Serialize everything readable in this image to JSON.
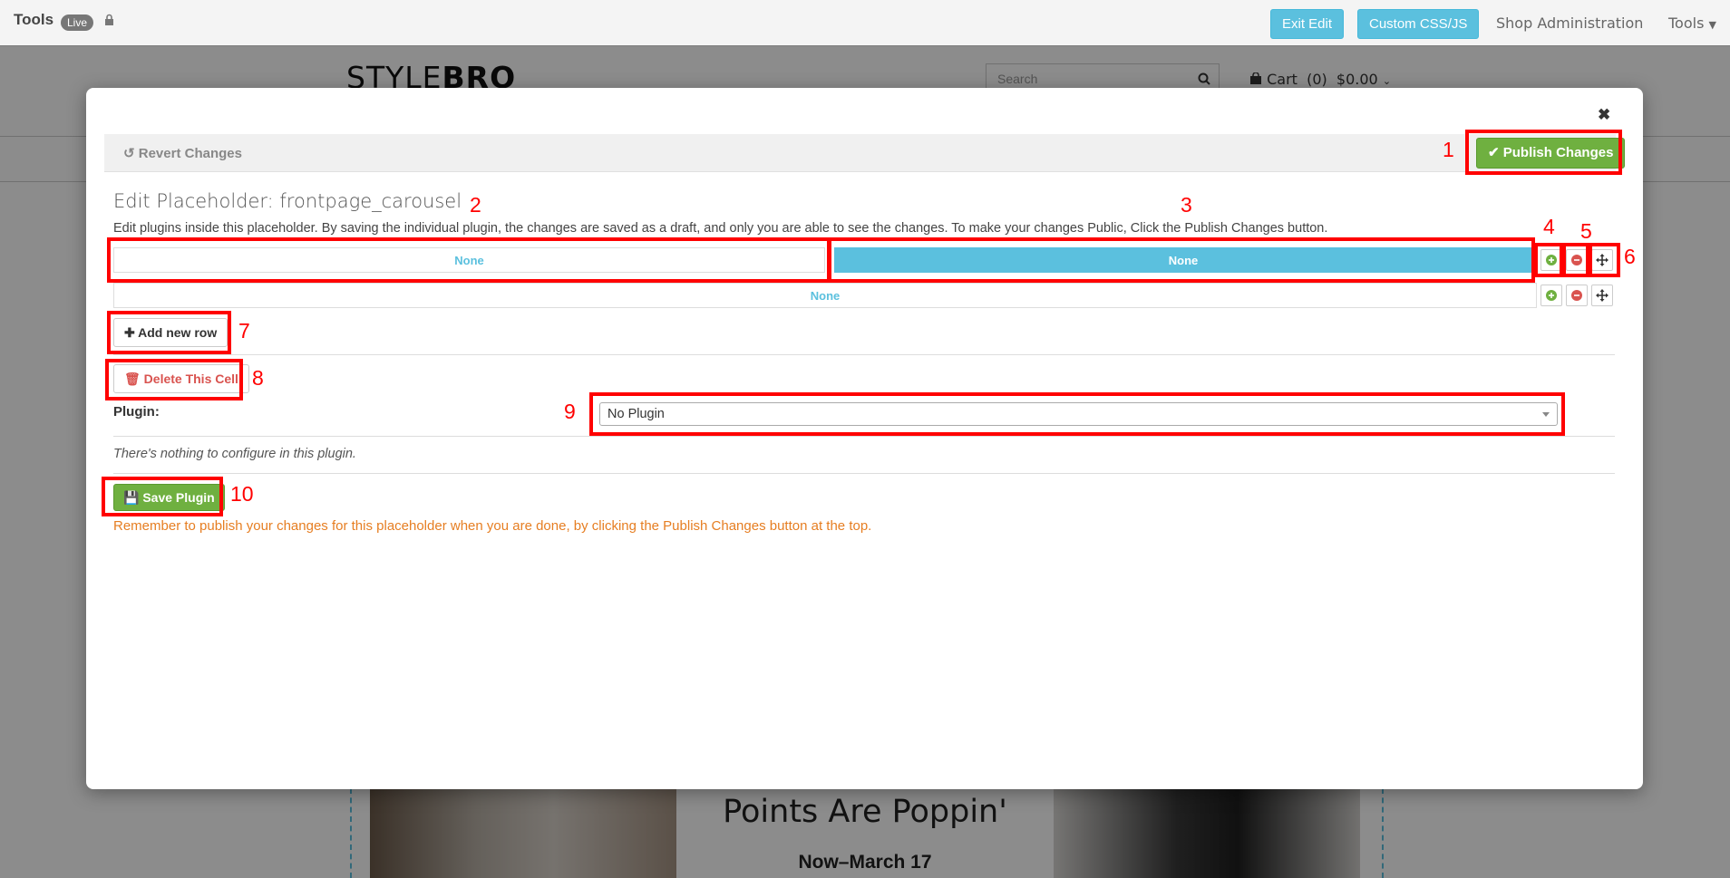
{
  "adminbar": {
    "title": "Tools",
    "live_badge": "Live",
    "exit_edit": "Exit Edit",
    "custom_css_js": "Custom CSS/JS",
    "shop_admin": "Shop Administration",
    "tools_menu": "Tools"
  },
  "site": {
    "logo_light": "STYLE",
    "logo_bold": "BRO",
    "search_placeholder": "Search",
    "cart": "Cart  (0)  $0.00",
    "hero_heading": "Points Are Poppin'",
    "hero_sub": "Now–March 17"
  },
  "modal": {
    "revert": "Revert Changes",
    "publish": "Publish Changes",
    "heading": "Edit Placeholder: frontpage_carousel",
    "description": "Edit plugins inside this placeholder. By saving the individual plugin, the changes are saved as a draft, and only you are able to see the changes. To make your changes Public, Click the Publish Changes button.",
    "row1": {
      "cell_a": "None",
      "cell_b": "None"
    },
    "row2": {
      "cell": "None"
    },
    "add_row": "Add new row",
    "delete_cell": "Delete This Cell",
    "plugin_label": "Plugin:",
    "plugin_selected": "No Plugin",
    "nothing_note": "There's nothing to configure in this plugin.",
    "save_plugin": "Save Plugin",
    "reminder": "Remember to publish your changes for this placeholder when you are done, by clicking the Publish Changes button at the top."
  },
  "annotations": [
    "1",
    "2",
    "3",
    "4",
    "5",
    "6",
    "7",
    "8",
    "9",
    "10"
  ],
  "colors": {
    "accent_blue": "#5bc0de",
    "green": "#6fb040",
    "orange": "#e67e22",
    "annotation_red": "#ff0000"
  }
}
